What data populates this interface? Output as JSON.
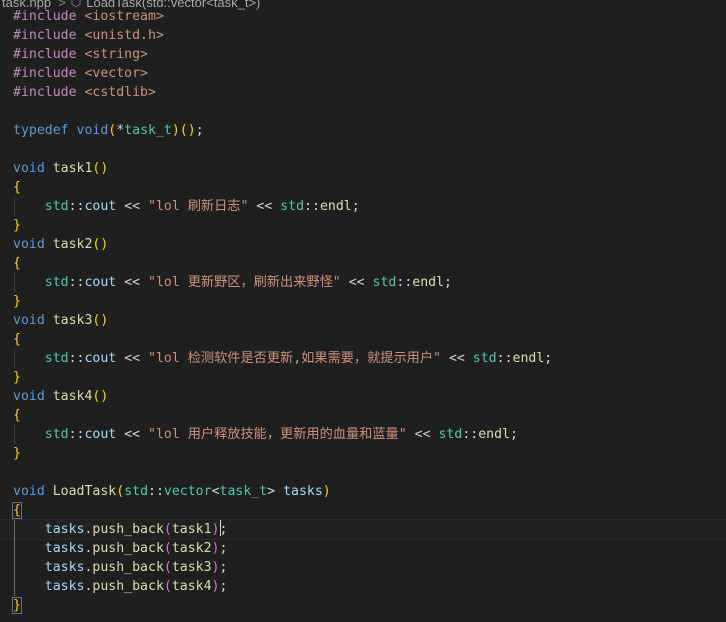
{
  "breadcrumb": {
    "file": "task.hpp",
    "separator": ">",
    "symbol_icon": "cube-symbol-icon",
    "symbol": "LoadTask(std::vector<task_t>)"
  },
  "colors": {
    "background": "#1f1f1f",
    "keyword": "#569cd6",
    "function": "#dcdcaa",
    "type": "#4ec9b0",
    "variable": "#9cdcfe",
    "string": "#ce9178",
    "preprocessor": "#c586c0"
  },
  "lines": [
    [
      "#include",
      "<iostream>"
    ],
    [
      "#include",
      "<unistd.h>"
    ],
    [
      "#include",
      "<string>"
    ],
    [
      "#include",
      "<vector>"
    ],
    [
      "#include",
      "<cstdlib>"
    ],
    [],
    [
      "typedef",
      "void",
      "(",
      "*",
      "task_t",
      ")",
      "(",
      ")",
      ";"
    ],
    [],
    [
      "void",
      "task1",
      "(",
      ")"
    ],
    [
      "{"
    ],
    [
      "std",
      "::",
      "cout",
      "<<",
      "\"lol 刷新日志\"",
      "<<",
      "std",
      "::",
      "endl",
      ";"
    ],
    [
      "}"
    ],
    [
      "void",
      "task2",
      "(",
      ")"
    ],
    [
      "{"
    ],
    [
      "std",
      "::",
      "cout",
      "<<",
      "\"lol 更新野区，刷新出来野怪\"",
      "<<",
      "std",
      "::",
      "endl",
      ";"
    ],
    [
      "}"
    ],
    [
      "void",
      "task3",
      "(",
      ")"
    ],
    [
      "{"
    ],
    [
      "std",
      "::",
      "cout",
      "<<",
      "\"lol 检测软件是否更新,如果需要，就提示用户\"",
      "<<",
      "std",
      "::",
      "endl",
      ";"
    ],
    [
      "}"
    ],
    [
      "void",
      "task4",
      "(",
      ")"
    ],
    [
      "{"
    ],
    [
      "std",
      "::",
      "cout",
      "<<",
      "\"lol 用户释放技能，更新用的血量和蓝量\"",
      "<<",
      "std",
      "::",
      "endl",
      ";"
    ],
    [
      "}"
    ],
    [],
    [
      "void",
      "LoadTask",
      "(",
      "std",
      "::",
      "vector",
      "<",
      "task_t",
      ">",
      "tasks",
      ")"
    ],
    [
      "{"
    ],
    [
      "tasks",
      ".",
      "push_back",
      "(",
      "task1",
      ")",
      ";"
    ],
    [
      "tasks",
      ".",
      "push_back",
      "(",
      "task2",
      ")",
      ";"
    ],
    [
      "tasks",
      ".",
      "push_back",
      "(",
      "task3",
      ")",
      ";"
    ],
    [
      "tasks",
      ".",
      "push_back",
      "(",
      "task4",
      ")",
      ";"
    ],
    [
      "}"
    ]
  ]
}
